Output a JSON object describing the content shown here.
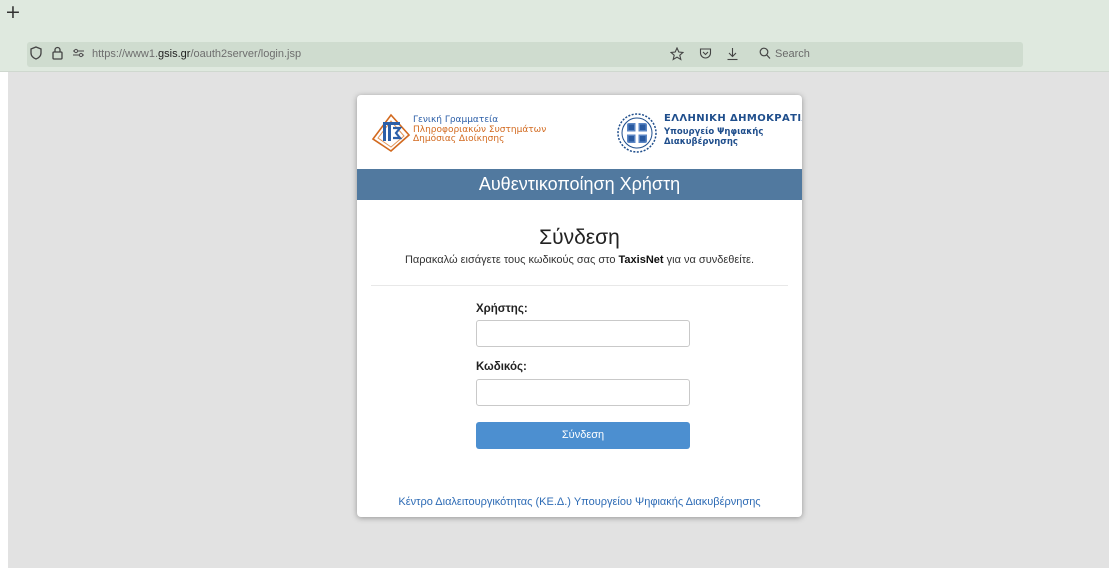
{
  "browser": {
    "new_tab_symbol": "+",
    "url_prefix": "https://www1.",
    "url_domain": "gsis.gr",
    "url_path": "/oauth2server/login.jsp",
    "search_placeholder": "Search",
    "icons": [
      "shield-icon",
      "lock-icon",
      "permissions-icon",
      "star-icon",
      "pocket-icon",
      "download-icon",
      "search-icon"
    ]
  },
  "header": {
    "left_logo_lines": [
      "Γενική Γραμματεία",
      "Πληροφοριακών Συστημάτων",
      "Δημόσιας Διοίκησης"
    ],
    "right_logo_title": "ΕΛΛΗΝΙΚΗ ΔΗΜΟΚΡΑΤΙΑ",
    "right_logo_lines": [
      "Υπουργείο Ψηφιακής",
      "Διακυβέρνησης"
    ]
  },
  "banner": {
    "title": "Αυθεντικοποίηση Χρήστη"
  },
  "login": {
    "title": "Σύνδεση",
    "subtitle_before": "Παρακαλώ εισάγετε τους κωδικούς σας στο ",
    "subtitle_bold": "TaxisNet",
    "subtitle_after": " για να συνδεθείτε.",
    "username_label": "Χρήστης:",
    "username_value": "",
    "password_label": "Κωδικός:",
    "password_value": "",
    "submit_label": "Σύνδεση"
  },
  "footer": {
    "link_text": "Κέντρο Διαλειτουργικότητας (ΚΕ.Δ.) Υπουργείου Ψηφιακής Διακυβέρνησης"
  },
  "colors": {
    "chrome": "#dfe9df",
    "viewport": "#e2e2e2",
    "banner": "#51799f",
    "button": "#4c8fd0",
    "link": "#2d6bb5",
    "logo_orange": "#d2691e",
    "logo_blue": "#1f4e8c"
  }
}
